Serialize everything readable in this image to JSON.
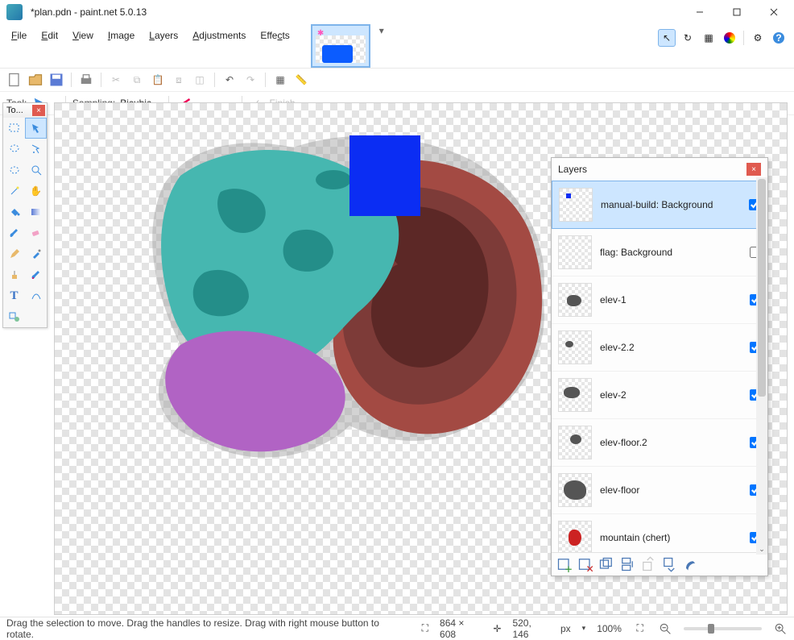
{
  "title": "*plan.pdn - paint.net 5.0.13",
  "menu": {
    "file": "File",
    "edit": "Edit",
    "view": "View",
    "image": "Image",
    "layers": "Layers",
    "adjustments": "Adjustments",
    "effects": "Effects"
  },
  "toolrow2": {
    "tool_label": "Tool:",
    "sampling_label": "Sampling:",
    "sampling_value": "Bicubic",
    "finish": "Finish"
  },
  "tools_window_title": "To...",
  "layers": {
    "title": "Layers",
    "items": [
      {
        "name": "manual-build: Background",
        "visible": true,
        "selected": true
      },
      {
        "name": "flag: Background",
        "visible": false,
        "selected": false
      },
      {
        "name": "elev-1",
        "visible": true,
        "selected": false
      },
      {
        "name": "elev-2.2",
        "visible": true,
        "selected": false
      },
      {
        "name": "elev-2",
        "visible": true,
        "selected": false
      },
      {
        "name": "elev-floor.2",
        "visible": true,
        "selected": false
      },
      {
        "name": "elev-floor",
        "visible": true,
        "selected": false
      },
      {
        "name": "mountain (chert)",
        "visible": true,
        "selected": false
      }
    ]
  },
  "status": {
    "hint": "Drag the selection to move. Drag the handles to resize. Drag with right mouse button to rotate.",
    "canvas_size": "864 × 608",
    "cursor_pos": "520, 146",
    "unit": "px",
    "zoom": "100%"
  },
  "icons": {
    "arrow": "↖",
    "history": "↺",
    "square": "▭",
    "wheel": "◐",
    "gear": "⚙",
    "help": "?"
  }
}
